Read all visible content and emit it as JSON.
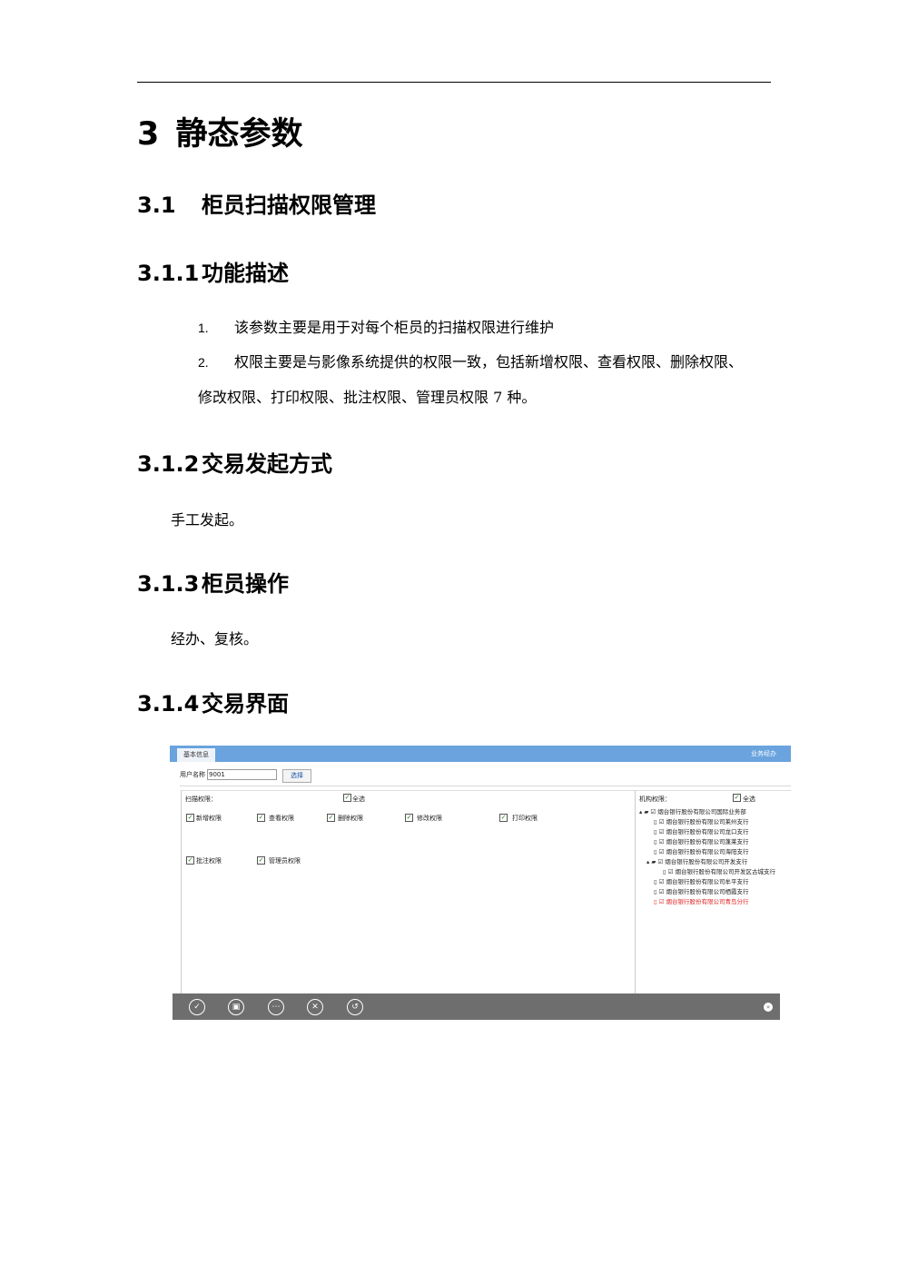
{
  "chapter": {
    "number": "3",
    "title": "静态参数"
  },
  "section": {
    "number": "3.1",
    "title": "柜员扫描权限管理"
  },
  "subsections": [
    {
      "number": "3.1.1",
      "title": "功能描述"
    },
    {
      "number": "3.1.2",
      "title": "交易发起方式"
    },
    {
      "number": "3.1.3",
      "title": "柜员操作"
    },
    {
      "number": "3.1.4",
      "title": "交易界面"
    }
  ],
  "func_list": [
    {
      "n": "1.",
      "text": "该参数主要是用于对每个柜员的扫描权限进行维护"
    },
    {
      "n": "2.",
      "text": "权限主要是与影像系统提供的权限一致，包括新增权限、查看权限、删除权限、",
      "cont": "修改权限、打印权限、批注权限、管理员权限 7 种。"
    }
  ],
  "initiation_text": "手工发起。",
  "operation_text": "经办、复核。",
  "screenshot": {
    "tab_label": "基本信息",
    "biz_link": "业务经办",
    "user_label": "用户名称",
    "user_value": "9001",
    "select_button": "选择",
    "scan_label": "扫描权限：",
    "select_all": "全选",
    "permissions": [
      "新增权限",
      "查看权限",
      "删除权限",
      "修改权限",
      "打印权限",
      "批注权限",
      "管理员权限"
    ],
    "org_label": "机构权限：",
    "org_select_all": "全选",
    "tree": [
      "烟台银行股份有限公司国际业务部",
      "烟台银行股份有限公司莱州支行",
      "烟台银行股份有限公司龙口支行",
      "烟台银行股份有限公司蓬莱支行",
      "烟台银行股份有限公司海阳支行",
      "烟台银行股份有限公司开发支行",
      "烟台银行股份有限公司开发区古城支行",
      "烟台银行股份有限公司牟平支行",
      "烟台银行股份有限公司栖霞支行",
      "烟台银行股份有限公司青岛分行"
    ],
    "toolbar_icons": [
      "confirm-icon",
      "save-icon",
      "more-icon",
      "cancel-icon",
      "back-icon",
      "next-icon"
    ]
  }
}
